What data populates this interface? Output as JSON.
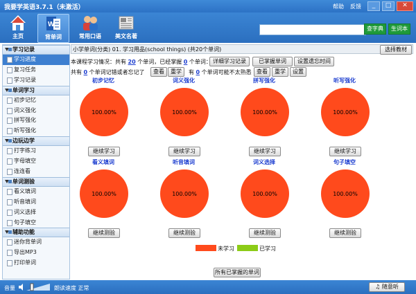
{
  "window": {
    "title": "我要学英语3.7.1（未激活）",
    "help": "帮助",
    "feedback": "反馈"
  },
  "toolbar": [
    {
      "label": "主页",
      "icon": "home-icon"
    },
    {
      "label": "背单词",
      "icon": "word-book-icon"
    },
    {
      "label": "常用口语",
      "icon": "people-icon"
    },
    {
      "label": "美文名著",
      "icon": "newspaper-icon"
    }
  ],
  "search": {
    "value": "",
    "dict_btn": "查字典",
    "vocab_btn": "生词本"
  },
  "sidebar": [
    {
      "group": "学习记录",
      "items": [
        "学习进度",
        "复习任务",
        "学习记录"
      ]
    },
    {
      "group": "单词学习",
      "items": [
        "初步记忆",
        "词义强化",
        "拼写强化",
        "听写强化"
      ]
    },
    {
      "group": "边玩边学",
      "items": [
        "打字练习",
        "字母填空",
        "连连看"
      ]
    },
    {
      "group": "单词测验",
      "items": [
        "看义填词",
        "听音填词",
        "词义选择",
        "句子填空"
      ]
    },
    {
      "group": "辅助功能",
      "items": [
        "迷你背单词",
        "导出MP3",
        "打印单词"
      ]
    }
  ],
  "selected_item": "学习进度",
  "content": {
    "breadcrumb": "小学单词(分类) 01. 学习用品(school things) (共20个单词)",
    "select_material": "选择教材",
    "line1_a": "本课程学习情况：共有",
    "total_words": "20",
    "line1_b": "个单词，已经掌握",
    "mastered": "0",
    "line1_c": "个单词：",
    "btn_detail": "详细学习记录",
    "btn_mastered": "已掌握单词",
    "btn_interval": "设置遗忘时间",
    "line2_a": "共有",
    "forgot_count": "0",
    "line2_b": "个单词记错或者忘记了",
    "btn_view1": "查看",
    "btn_relearn1": "重学",
    "line2_c": "有",
    "unfamiliar_count": "0",
    "line2_d": "个单词可能不太熟悉",
    "btn_view2": "查看",
    "btn_relearn2": "重学",
    "btn_setting": "设置",
    "all_mastered": "所有已掌握的单词"
  },
  "colors": {
    "unlearned": "#ff4a1c",
    "learned": "#8ccc17",
    "link": "#1a3ccf",
    "bar": "#2f78c9"
  },
  "charts": [
    {
      "title": "初步记忆",
      "button": "继续学习"
    },
    {
      "title": "词义强化",
      "button": "继续学习"
    },
    {
      "title": "拼写强化",
      "button": "继续学习"
    },
    {
      "title": "听写强化",
      "button": "继续学习"
    },
    {
      "title": "看义填词",
      "button": "继续测验"
    },
    {
      "title": "听音填词",
      "button": "继续测验"
    },
    {
      "title": "词义选择",
      "button": "继续测验"
    },
    {
      "title": "句子填空",
      "button": "继续测验"
    }
  ],
  "chart_data": [
    {
      "type": "pie",
      "title": "初步记忆",
      "labels": [
        "未学习",
        "已学习"
      ],
      "values": [
        100,
        0
      ],
      "slice_labels": [
        "100.00%"
      ]
    },
    {
      "type": "pie",
      "title": "词义强化",
      "labels": [
        "未学习",
        "已学习"
      ],
      "values": [
        100,
        0
      ],
      "slice_labels": [
        "100.00%"
      ]
    },
    {
      "type": "pie",
      "title": "拼写强化",
      "labels": [
        "未学习",
        "已学习"
      ],
      "values": [
        100,
        0
      ],
      "slice_labels": [
        "100.00%"
      ]
    },
    {
      "type": "pie",
      "title": "听写强化",
      "labels": [
        "未学习",
        "已学习"
      ],
      "values": [
        100,
        0
      ],
      "slice_labels": [
        "100.00%"
      ]
    },
    {
      "type": "pie",
      "title": "看义填词",
      "labels": [
        "未学习",
        "已学习"
      ],
      "values": [
        100,
        0
      ],
      "slice_labels": [
        "100.00%"
      ]
    },
    {
      "type": "pie",
      "title": "听音填词",
      "labels": [
        "未学习",
        "已学习"
      ],
      "values": [
        100,
        0
      ],
      "slice_labels": [
        "100.00%"
      ]
    },
    {
      "type": "pie",
      "title": "词义选择",
      "labels": [
        "未学习",
        "已学习"
      ],
      "values": [
        100,
        0
      ],
      "slice_labels": [
        "100.00%"
      ]
    },
    {
      "type": "pie",
      "title": "句子填空",
      "labels": [
        "未学习",
        "已学习"
      ],
      "values": [
        100,
        0
      ],
      "slice_labels": [
        "100.00%"
      ]
    }
  ],
  "legend": [
    {
      "label": "未学习"
    },
    {
      "label": "已学习"
    }
  ],
  "status": {
    "volume": "音量",
    "speed": "朗读速度 正常",
    "random_listen": "随意听"
  }
}
